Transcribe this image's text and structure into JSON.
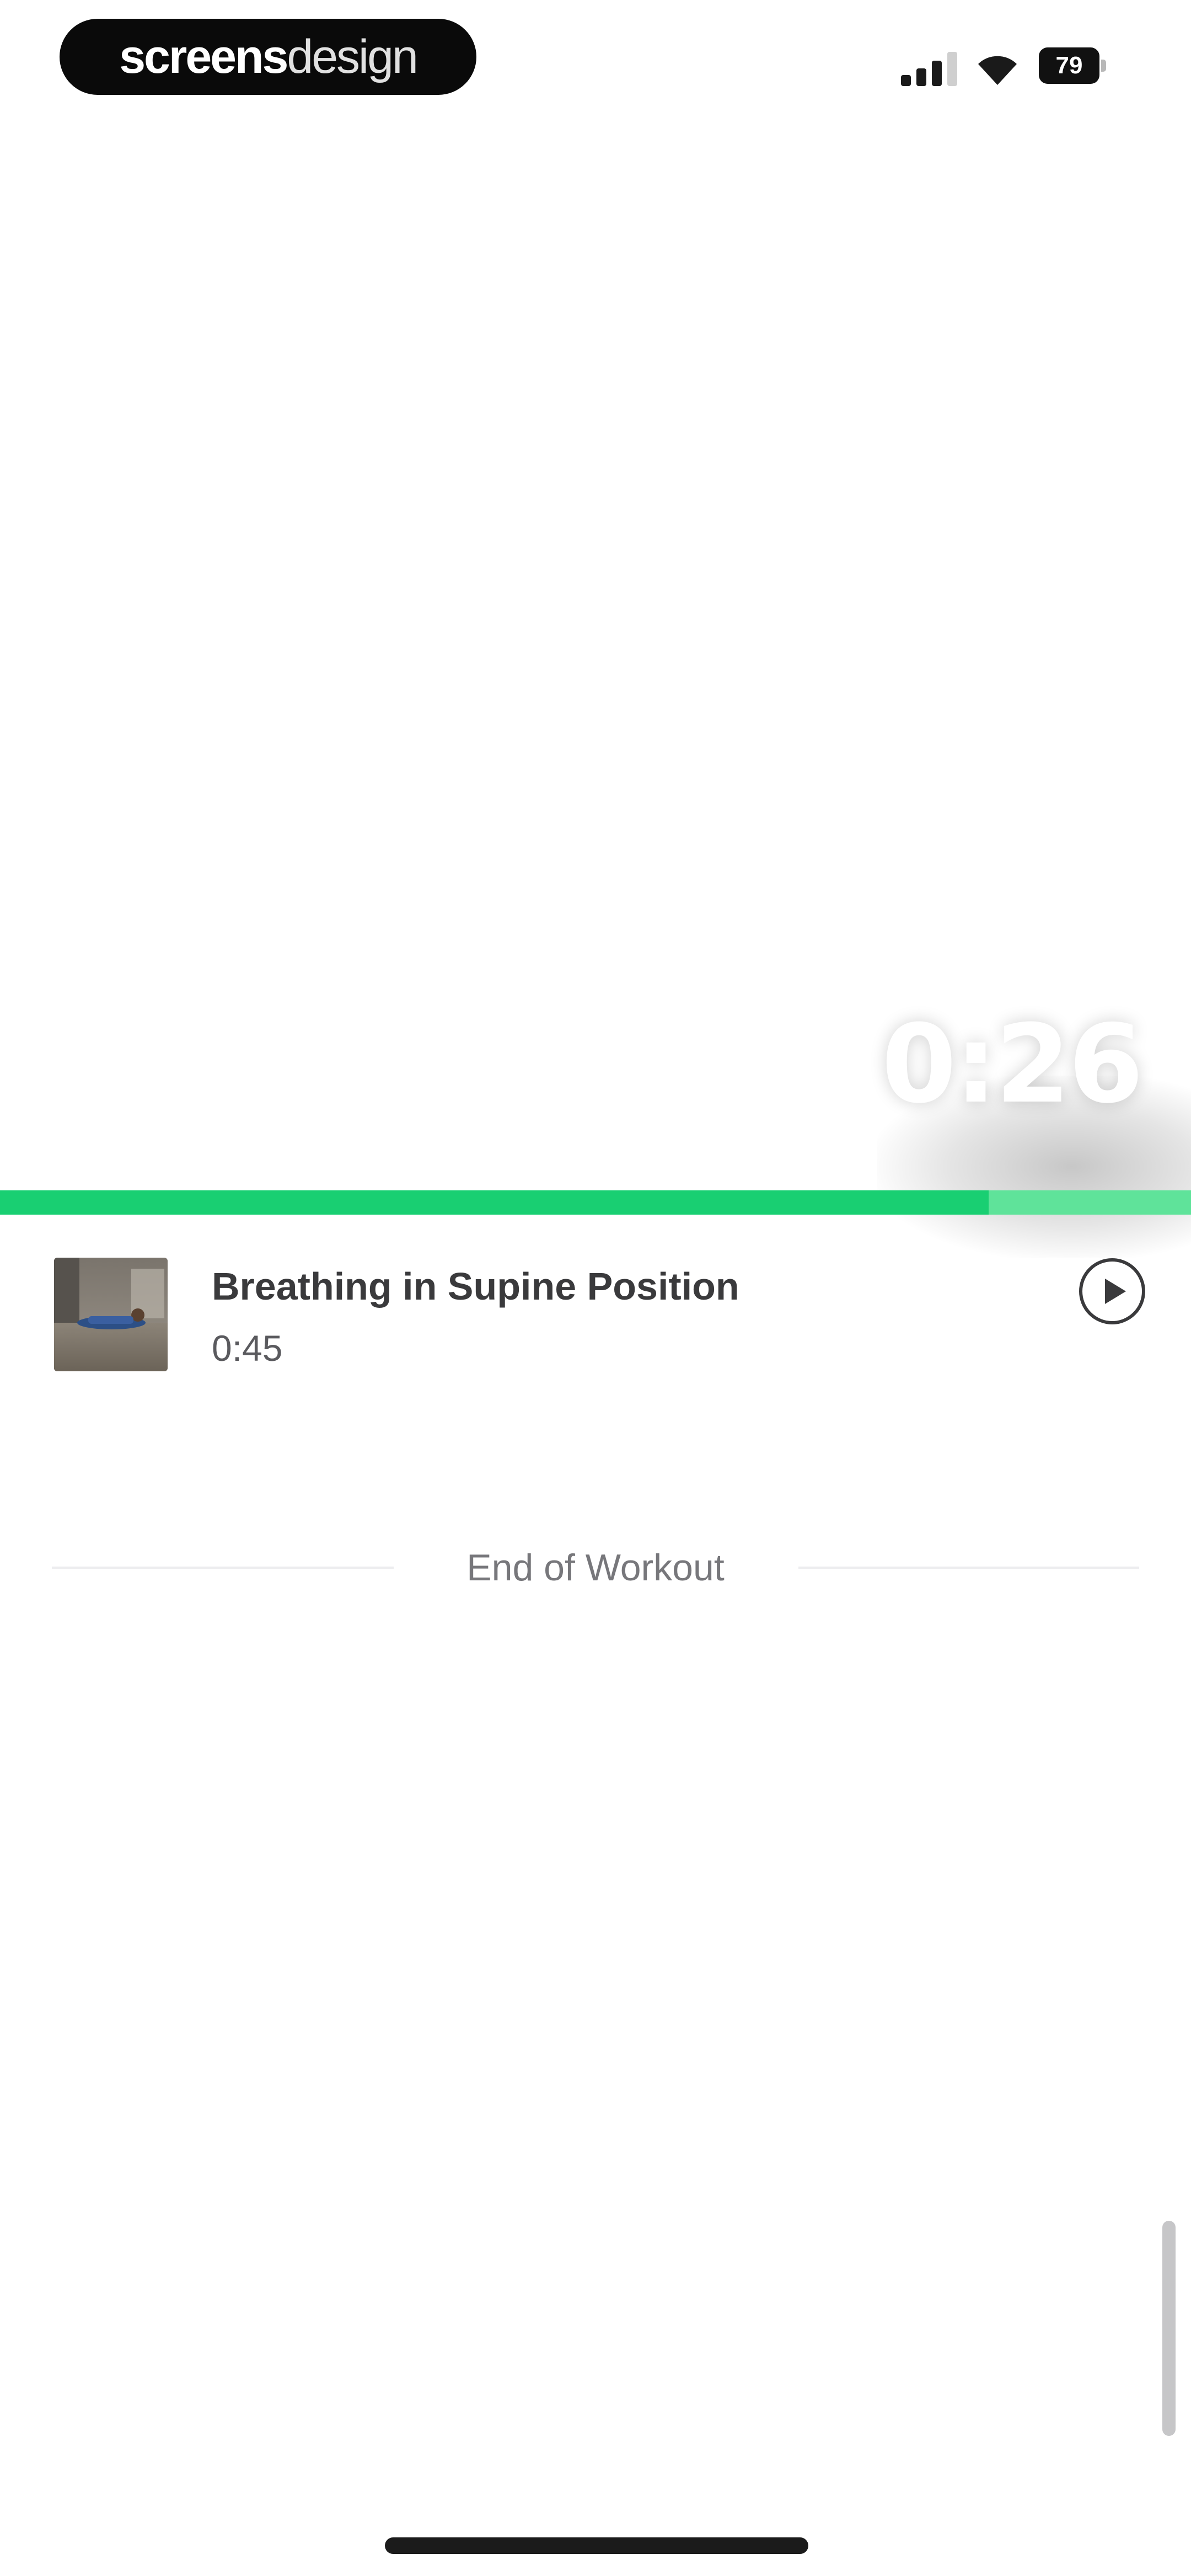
{
  "status_bar": {
    "watermark_bold": "screens",
    "watermark_light": "design",
    "battery_level": "79",
    "signal_bars_active": 3,
    "signal_bars_total": 4
  },
  "video": {
    "countdown": "0:26"
  },
  "progress": {
    "fraction": 0.83,
    "track_color": "#5fe39a",
    "fill_color": "#19cf72"
  },
  "exercise": {
    "title": "Breathing in Supine Position",
    "duration": "0:45",
    "thumbnail_icon": "exercise-thumbnail",
    "play_icon": "play-icon"
  },
  "end": {
    "label": "End of Workout"
  }
}
